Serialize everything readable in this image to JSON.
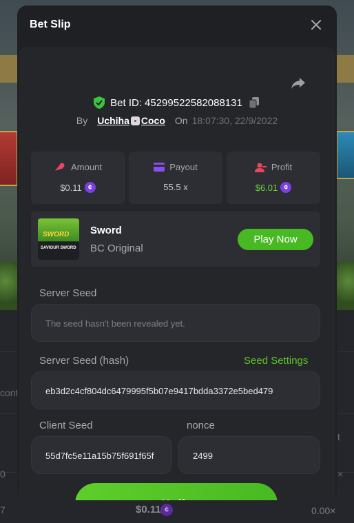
{
  "modal": {
    "title": "Bet Slip"
  },
  "bet": {
    "id_label": "Bet ID:",
    "id": "4529952258208813​1",
    "by_label": "By",
    "user_first": "Uchiha",
    "user_second": "Coco",
    "on_label": "On",
    "timestamp": "18:07:30, 22/9/2022"
  },
  "stats": {
    "amount_label": "Amount",
    "amount_value": "$0.11",
    "payout_label": "Payout",
    "payout_value": "55.5 x",
    "profit_label": "Profit",
    "profit_value": "$6.01",
    "coin_symbol": "¢"
  },
  "game": {
    "name": "Sword",
    "type": "BC Original",
    "thumb_title": "SWORD",
    "thumb_sub": "SAVIOUR SWORD",
    "play_label": "Play Now"
  },
  "fields": {
    "server_seed_label": "Server Seed",
    "server_seed_value": "The seed hasn't been revealed yet.",
    "server_hash_label": "Server Seed (hash)",
    "seed_settings_label": "Seed Settings",
    "server_hash_value": "eb3d2c4cf804dc6479995f5b07e9417bdda3372e5bed479",
    "client_seed_label": "Client Seed",
    "client_seed_value": "55d7fc5e11a15b75f691f65f",
    "nonce_label": "nonce",
    "nonce_value": "2499"
  },
  "verify_label": "Verify",
  "background": {
    "amount": "$0.11",
    "multiplier": "0.00×",
    "left_text_1": "cont",
    "left_text_2": "0",
    "left_text_3": "7",
    "right_text_1": "t",
    "right_text_2": "×"
  },
  "colors": {
    "accent_green": "#49b923",
    "profit_green": "#6fd33b",
    "coin_purple": "#7b3fe4",
    "modal_bg": "#1f2024"
  }
}
